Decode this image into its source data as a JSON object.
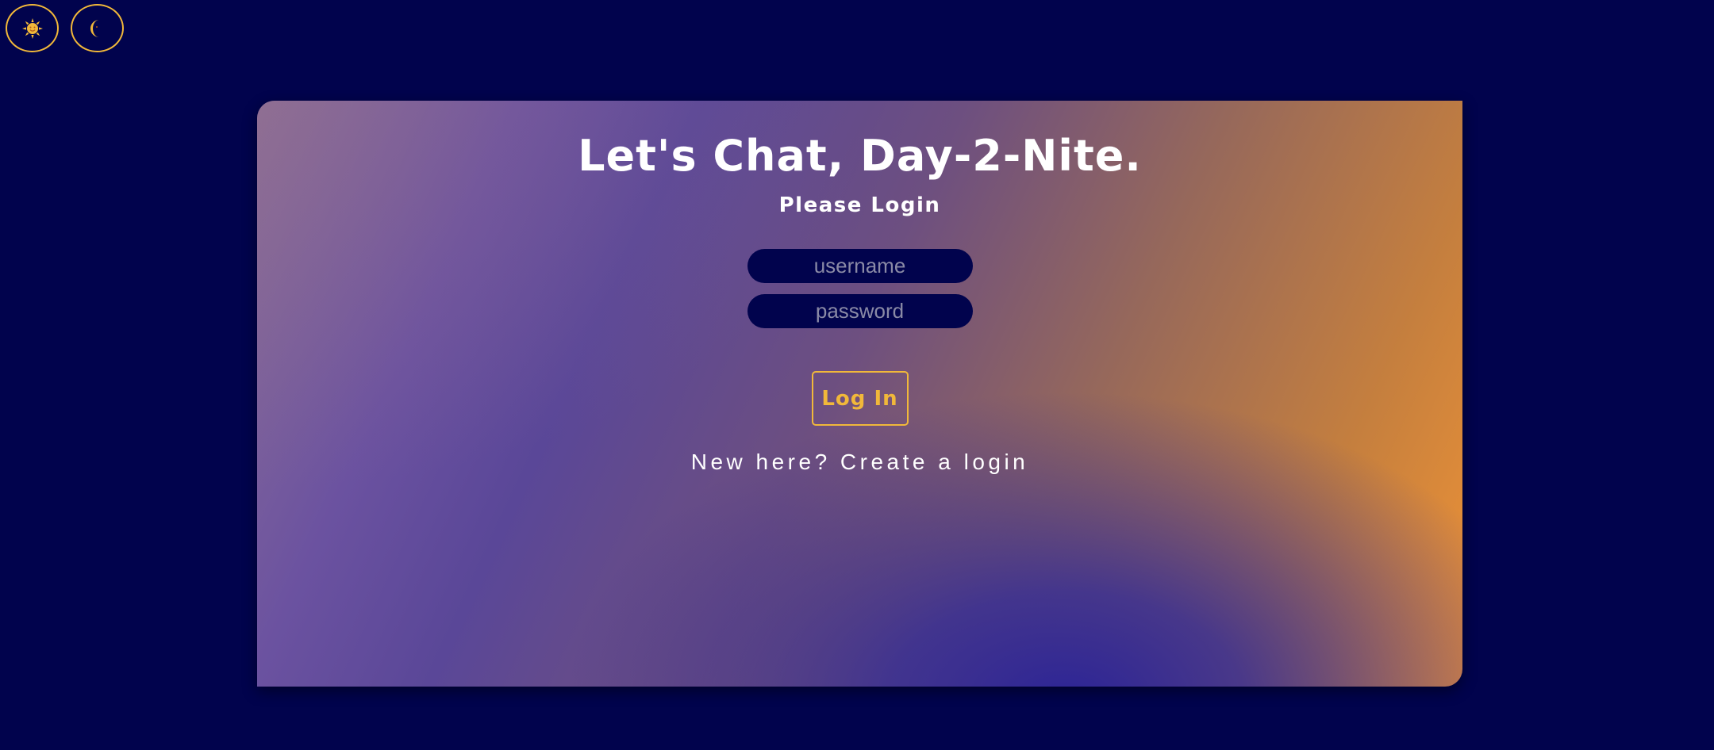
{
  "theme_toggles": {
    "day_icon": "sun-icon",
    "night_icon": "moon-icon"
  },
  "login": {
    "title": "Let's Chat, Day-2-Nite.",
    "subtitle": "Please Login",
    "username_placeholder": "username",
    "username_value": "",
    "password_placeholder": "password",
    "password_value": "",
    "submit_label": "Log In",
    "signup_prompt": "New here?",
    "signup_link": "Create a login"
  },
  "colors": {
    "page_background": "#01034d",
    "accent": "#f1b83a",
    "field_background": "#01034d",
    "text": "#ffffff",
    "gradient_start": "#8c6f96",
    "gradient_mid": "#2c2496",
    "gradient_end": "#ef9336"
  }
}
